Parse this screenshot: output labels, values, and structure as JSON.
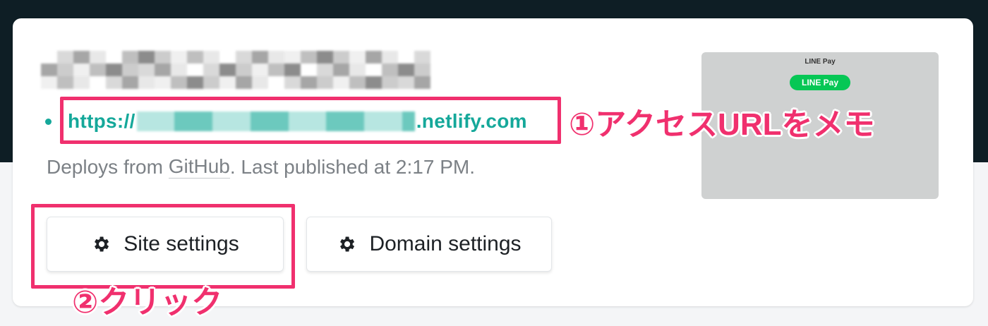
{
  "site": {
    "url_prefix": "https://",
    "url_suffix": ".netlify.com",
    "deploy_prefix": "Deploys from ",
    "deploy_link": "GitHub",
    "deploy_suffix": ". Last published at 2:17 PM."
  },
  "preview": {
    "title": "LINE Pay",
    "badge": "LINE Pay"
  },
  "buttons": {
    "site_settings": "Site settings",
    "domain_settings": "Domain settings"
  },
  "annotations": {
    "step1": "①アクセスURLをメモ",
    "step2": "②クリック"
  },
  "colors": {
    "accent": "#15a89a",
    "highlight": "#f0306e",
    "header_bg": "#0e1e25"
  },
  "icons": {
    "settings": "gear-icon"
  }
}
